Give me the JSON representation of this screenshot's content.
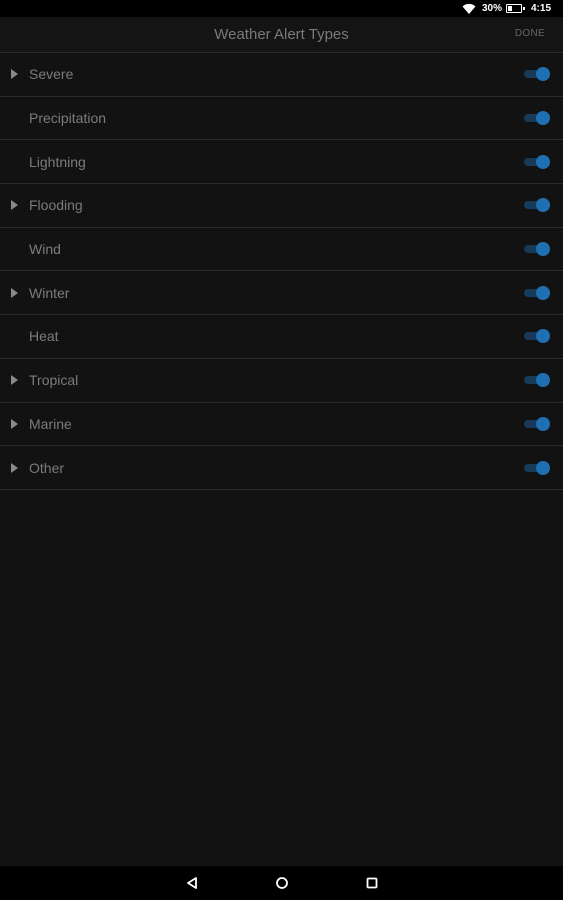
{
  "status_bar": {
    "battery_percent": "30%",
    "time": "4:15"
  },
  "header": {
    "title": "Weather Alert Types",
    "done_label": "DONE"
  },
  "alerts": [
    {
      "label": "Severe",
      "expandable": true,
      "enabled": true
    },
    {
      "label": "Precipitation",
      "expandable": false,
      "enabled": true
    },
    {
      "label": "Lightning",
      "expandable": false,
      "enabled": true
    },
    {
      "label": "Flooding",
      "expandable": true,
      "enabled": true
    },
    {
      "label": "Wind",
      "expandable": false,
      "enabled": true
    },
    {
      "label": "Winter",
      "expandable": true,
      "enabled": true
    },
    {
      "label": "Heat",
      "expandable": false,
      "enabled": true
    },
    {
      "label": "Tropical",
      "expandable": true,
      "enabled": true
    },
    {
      "label": "Marine",
      "expandable": true,
      "enabled": true
    },
    {
      "label": "Other",
      "expandable": true,
      "enabled": true
    }
  ],
  "colors": {
    "toggle_on_thumb": "#1f6fb3",
    "toggle_on_track": "#163a58",
    "background": "#121212"
  },
  "icons": {
    "wifi": "wifi-icon",
    "battery": "battery-charging-icon",
    "expand": "triangle-right-icon",
    "back": "back-triangle-icon",
    "home": "home-circle-icon",
    "recents": "recents-square-icon"
  }
}
